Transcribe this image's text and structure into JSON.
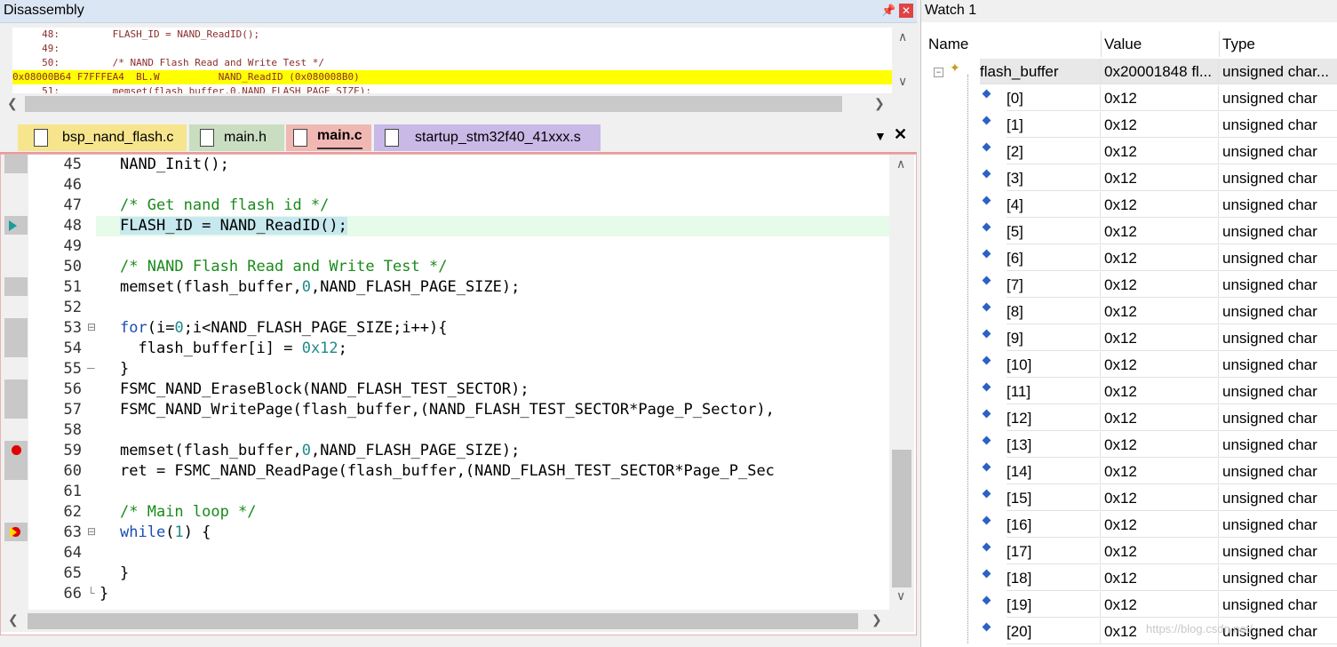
{
  "disassembly": {
    "title": "Disassembly",
    "lines": [
      {
        "text": "     48:         FLASH_ID = NAND_ReadID();",
        "highlight": false
      },
      {
        "text": "     49: ",
        "highlight": false
      },
      {
        "text": "     50:         /* NAND Flash Read and Write Test */",
        "highlight": false
      },
      {
        "text": "0x08000B64 F7FFFEA4  BL.W          NAND_ReadID (0x080008B0)",
        "highlight": true
      },
      {
        "text": "     51:         memset(flash_buffer,0,NAND_FLASH_PAGE_SIZE);",
        "highlight": false
      }
    ]
  },
  "tabs": [
    {
      "label": "bsp_nand_flash.c",
      "color": "#f7e58e"
    },
    {
      "label": "main.h",
      "color": "#c9ddc0"
    },
    {
      "label": "main.c",
      "color": "#f1b8b3",
      "active": true
    },
    {
      "label": "startup_stm32f40_41xxx.s",
      "color": "#c8b9e6"
    }
  ],
  "editor": {
    "lines": [
      {
        "n": "45",
        "code": "NAND_Init();"
      },
      {
        "n": "46",
        "code": ""
      },
      {
        "n": "47",
        "code": "/* Get nand flash id */"
      },
      {
        "n": "48",
        "code": "FLASH_ID = NAND_ReadID();"
      },
      {
        "n": "49",
        "code": ""
      },
      {
        "n": "50",
        "code": "/* NAND Flash Read and Write Test */"
      },
      {
        "n": "51",
        "code": "memset(flash_buffer,0,NAND_FLASH_PAGE_SIZE);"
      },
      {
        "n": "52",
        "code": ""
      },
      {
        "n": "53",
        "code": "for(i=0;i<NAND_FLASH_PAGE_SIZE;i++){"
      },
      {
        "n": "54",
        "code": "  flash_buffer[i] = 0x12;"
      },
      {
        "n": "55",
        "code": "}"
      },
      {
        "n": "56",
        "code": "FSMC_NAND_EraseBlock(NAND_FLASH_TEST_SECTOR);"
      },
      {
        "n": "57",
        "code": "FSMC_NAND_WritePage(flash_buffer,(NAND_FLASH_TEST_SECTOR*Page_P_Sector),"
      },
      {
        "n": "58",
        "code": ""
      },
      {
        "n": "59",
        "code": "memset(flash_buffer,0,NAND_FLASH_PAGE_SIZE);"
      },
      {
        "n": "60",
        "code": "ret = FSMC_NAND_ReadPage(flash_buffer,(NAND_FLASH_TEST_SECTOR*Page_P_Sec"
      },
      {
        "n": "61",
        "code": ""
      },
      {
        "n": "62",
        "code": "/* Main loop */"
      },
      {
        "n": "63",
        "code": "while(1) {"
      },
      {
        "n": "64",
        "code": ""
      },
      {
        "n": "65",
        "code": "}"
      },
      {
        "n": "66",
        "code": "}"
      }
    ]
  },
  "watch": {
    "title": "Watch 1",
    "headers": {
      "name": "Name",
      "value": "Value",
      "type": "Type"
    },
    "root": {
      "name": "flash_buffer",
      "value": "0x20001848 fl...",
      "type": "unsigned char..."
    },
    "items": [
      {
        "name": "[0]",
        "value": "0x12",
        "type": "unsigned char"
      },
      {
        "name": "[1]",
        "value": "0x12",
        "type": "unsigned char"
      },
      {
        "name": "[2]",
        "value": "0x12",
        "type": "unsigned char"
      },
      {
        "name": "[3]",
        "value": "0x12",
        "type": "unsigned char"
      },
      {
        "name": "[4]",
        "value": "0x12",
        "type": "unsigned char"
      },
      {
        "name": "[5]",
        "value": "0x12",
        "type": "unsigned char"
      },
      {
        "name": "[6]",
        "value": "0x12",
        "type": "unsigned char"
      },
      {
        "name": "[7]",
        "value": "0x12",
        "type": "unsigned char"
      },
      {
        "name": "[8]",
        "value": "0x12",
        "type": "unsigned char"
      },
      {
        "name": "[9]",
        "value": "0x12",
        "type": "unsigned char"
      },
      {
        "name": "[10]",
        "value": "0x12",
        "type": "unsigned char"
      },
      {
        "name": "[11]",
        "value": "0x12",
        "type": "unsigned char"
      },
      {
        "name": "[12]",
        "value": "0x12",
        "type": "unsigned char"
      },
      {
        "name": "[13]",
        "value": "0x12",
        "type": "unsigned char"
      },
      {
        "name": "[14]",
        "value": "0x12",
        "type": "unsigned char"
      },
      {
        "name": "[15]",
        "value": "0x12",
        "type": "unsigned char"
      },
      {
        "name": "[16]",
        "value": "0x12",
        "type": "unsigned char"
      },
      {
        "name": "[17]",
        "value": "0x12",
        "type": "unsigned char"
      },
      {
        "name": "[18]",
        "value": "0x12",
        "type": "unsigned char"
      },
      {
        "name": "[19]",
        "value": "0x12",
        "type": "unsigned char"
      },
      {
        "name": "[20]",
        "value": "0x12",
        "type": "unsigned char"
      }
    ]
  },
  "watermark": "https://blog.csdn.net/..."
}
